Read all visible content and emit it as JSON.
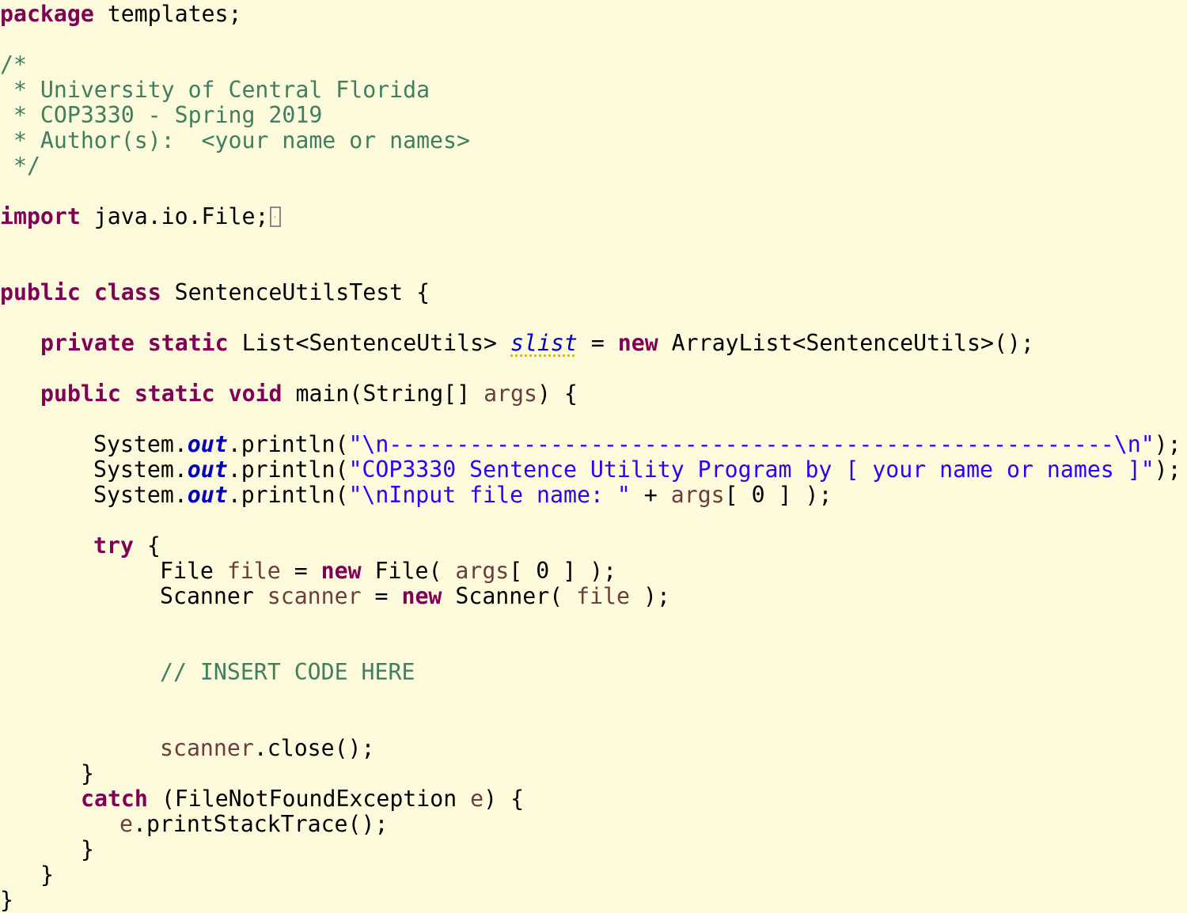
{
  "editor": {
    "language": "java",
    "colors": {
      "background": "#fefbdc",
      "keyword": "#7f0055",
      "comment": "#3f7f5f",
      "string": "#2a00ff",
      "local_variable": "#6a3e3e",
      "static_field": "#0000c0",
      "warning_underline": "#f0b400"
    },
    "package_line": {
      "keyword": "package",
      "name": " templates;"
    },
    "header_comment": [
      "/*",
      " * University of Central Florida",
      " * COP3330 - Spring 2019",
      " * Author(s):  <your name or names>",
      " */"
    ],
    "import_line": {
      "keyword": "import",
      "name": " java.io.File;",
      "folded_marker": "collapsed-imports"
    },
    "class_decl": {
      "kw1": "public",
      "kw2": "class",
      "rest": " SentenceUtilsTest {"
    },
    "field_decl": {
      "kw1": "private",
      "kw2": "static",
      "type": " List<SentenceUtils> ",
      "name": "slist",
      "eq": " = ",
      "kw_new": "new",
      "rest": " ArrayList<SentenceUtils>();"
    },
    "main_decl": {
      "kw1": "public",
      "kw2": "static",
      "kw3": "void",
      "rest": " main(String[] ",
      "param": "args",
      "end": ") {"
    },
    "println_lines": [
      {
        "prefix": "System.",
        "field": "out",
        "call": ".println(",
        "string": "\"\\n------------------------------------------------------\\n\"",
        "suffix": ");"
      },
      {
        "prefix": "System.",
        "field": "out",
        "call": ".println(",
        "string": "\"COP3330 Sentence Utility Program by [ your name or names ]\"",
        "suffix": ");"
      },
      {
        "prefix": "System.",
        "field": "out",
        "call": ".println(",
        "string": "\"\\nInput file name: \"",
        "plus": " + ",
        "var": "args",
        "suffix": "[ 0 ] );"
      }
    ],
    "try_line": {
      "keyword": "try",
      "rest": " {"
    },
    "file_line": {
      "type": "File ",
      "var": "file",
      "eq": " = ",
      "kw_new": "new",
      "call": " File( ",
      "arg": "args",
      "end": "[ 0 ] );"
    },
    "scanner_line": {
      "type": "Scanner ",
      "var": "scanner",
      "eq": " = ",
      "kw_new": "new",
      "call": " Scanner( ",
      "arg": "file",
      "end": " );"
    },
    "insert_comment": "// INSERT CODE HERE",
    "close_line": {
      "var": "scanner",
      "rest": ".close();"
    },
    "close_brace_try": "}",
    "catch_line": {
      "keyword": "catch",
      "rest": " (FileNotFoundException ",
      "var": "e",
      "end": ") {"
    },
    "stack_line": {
      "var": "e",
      "rest": ".printStackTrace();"
    },
    "close_brace_catch": "}",
    "close_brace_main": "}",
    "close_brace_class": "}"
  }
}
